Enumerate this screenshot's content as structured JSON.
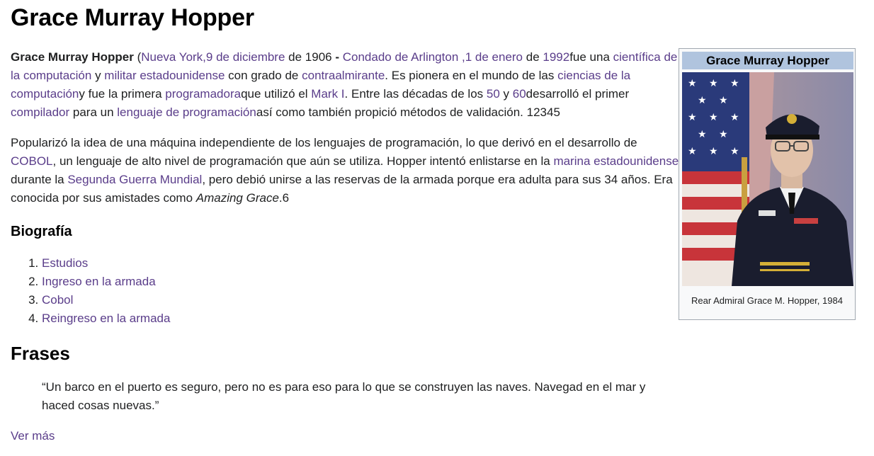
{
  "title": "Grace Murray Hopper",
  "intro": {
    "name": "Grace Murray Hopper",
    "open_paren": " (",
    "link_nueva_york": "Nueva York,",
    "link_9_diciembre": "9 de diciembre",
    "t_de_1906": " de 1906 ",
    "dash": "-",
    "link_condado": "Condado de Arlington ,",
    "link_1_enero": "1 de enero",
    "t_de": " de ",
    "link_1992": "1992",
    "t_fue_una": "fue una ",
    "link_cientifica": "científica de la computación",
    "t_y": " y ",
    "link_militar": "militar estadounidense",
    "t_con_grado": " con grado de ",
    "link_contraalmirante": "contraalmirante",
    "t_pionera": ". Es pionera en el mundo de las ",
    "link_ciencias": "ciencias de la computación",
    "t_fue_primera": "y fue la primera ",
    "link_programadora": "programadora",
    "t_que_utilizo": "que utilizó el ",
    "link_mark": "Mark I",
    "t_entre": ". Entre las décadas de los ",
    "link_50": "50",
    "t_y2": " y ",
    "link_60": "60",
    "t_desarrollo": "desarrolló el primer ",
    "link_compilador": "compilador",
    "t_para_un": " para un ",
    "link_lenguaje": "lenguaje de programación",
    "t_asi_como": "así como también propició métodos de validación. 12345"
  },
  "para2": {
    "t1": "Popularizó la idea de una máquina independiente de los lenguajes de programación, lo que derivó en el desarrollo de ",
    "link_cobol": "COBOL",
    "t2": ", un lenguaje de alto nivel de programación que aún se utiliza. Hopper intentó enlistarse en la ",
    "link_marina": "marina estadounidense",
    "t3": " durante la ",
    "link_sgm": "Segunda Guerra Mundial",
    "t4": ", pero debió unirse a las reservas de la armada porque era adulta para sus 34 años. Era conocida por sus amistades como ",
    "amazing": "Amazing Grace",
    "t5": ".6"
  },
  "biografia": {
    "heading": "Biografía",
    "items": [
      "Estudios",
      "Ingreso en la armada",
      "Cobol",
      "Reingreso en la armada"
    ]
  },
  "frases": {
    "heading": "Frases",
    "quote": "“Un barco en el puerto es seguro, pero no es para eso para lo que se construyen las naves. Navegad en el mar y haced cosas nuevas.”",
    "ver_mas": "Ver más"
  },
  "infobox": {
    "title": "Grace Murray Hopper",
    "caption": "Rear Admiral Grace M. Hopper, 1984"
  },
  "colors": {
    "link": "#5a3d8a",
    "infobox_header": "#b0c4de",
    "infobox_bg": "#f8f9fa"
  }
}
